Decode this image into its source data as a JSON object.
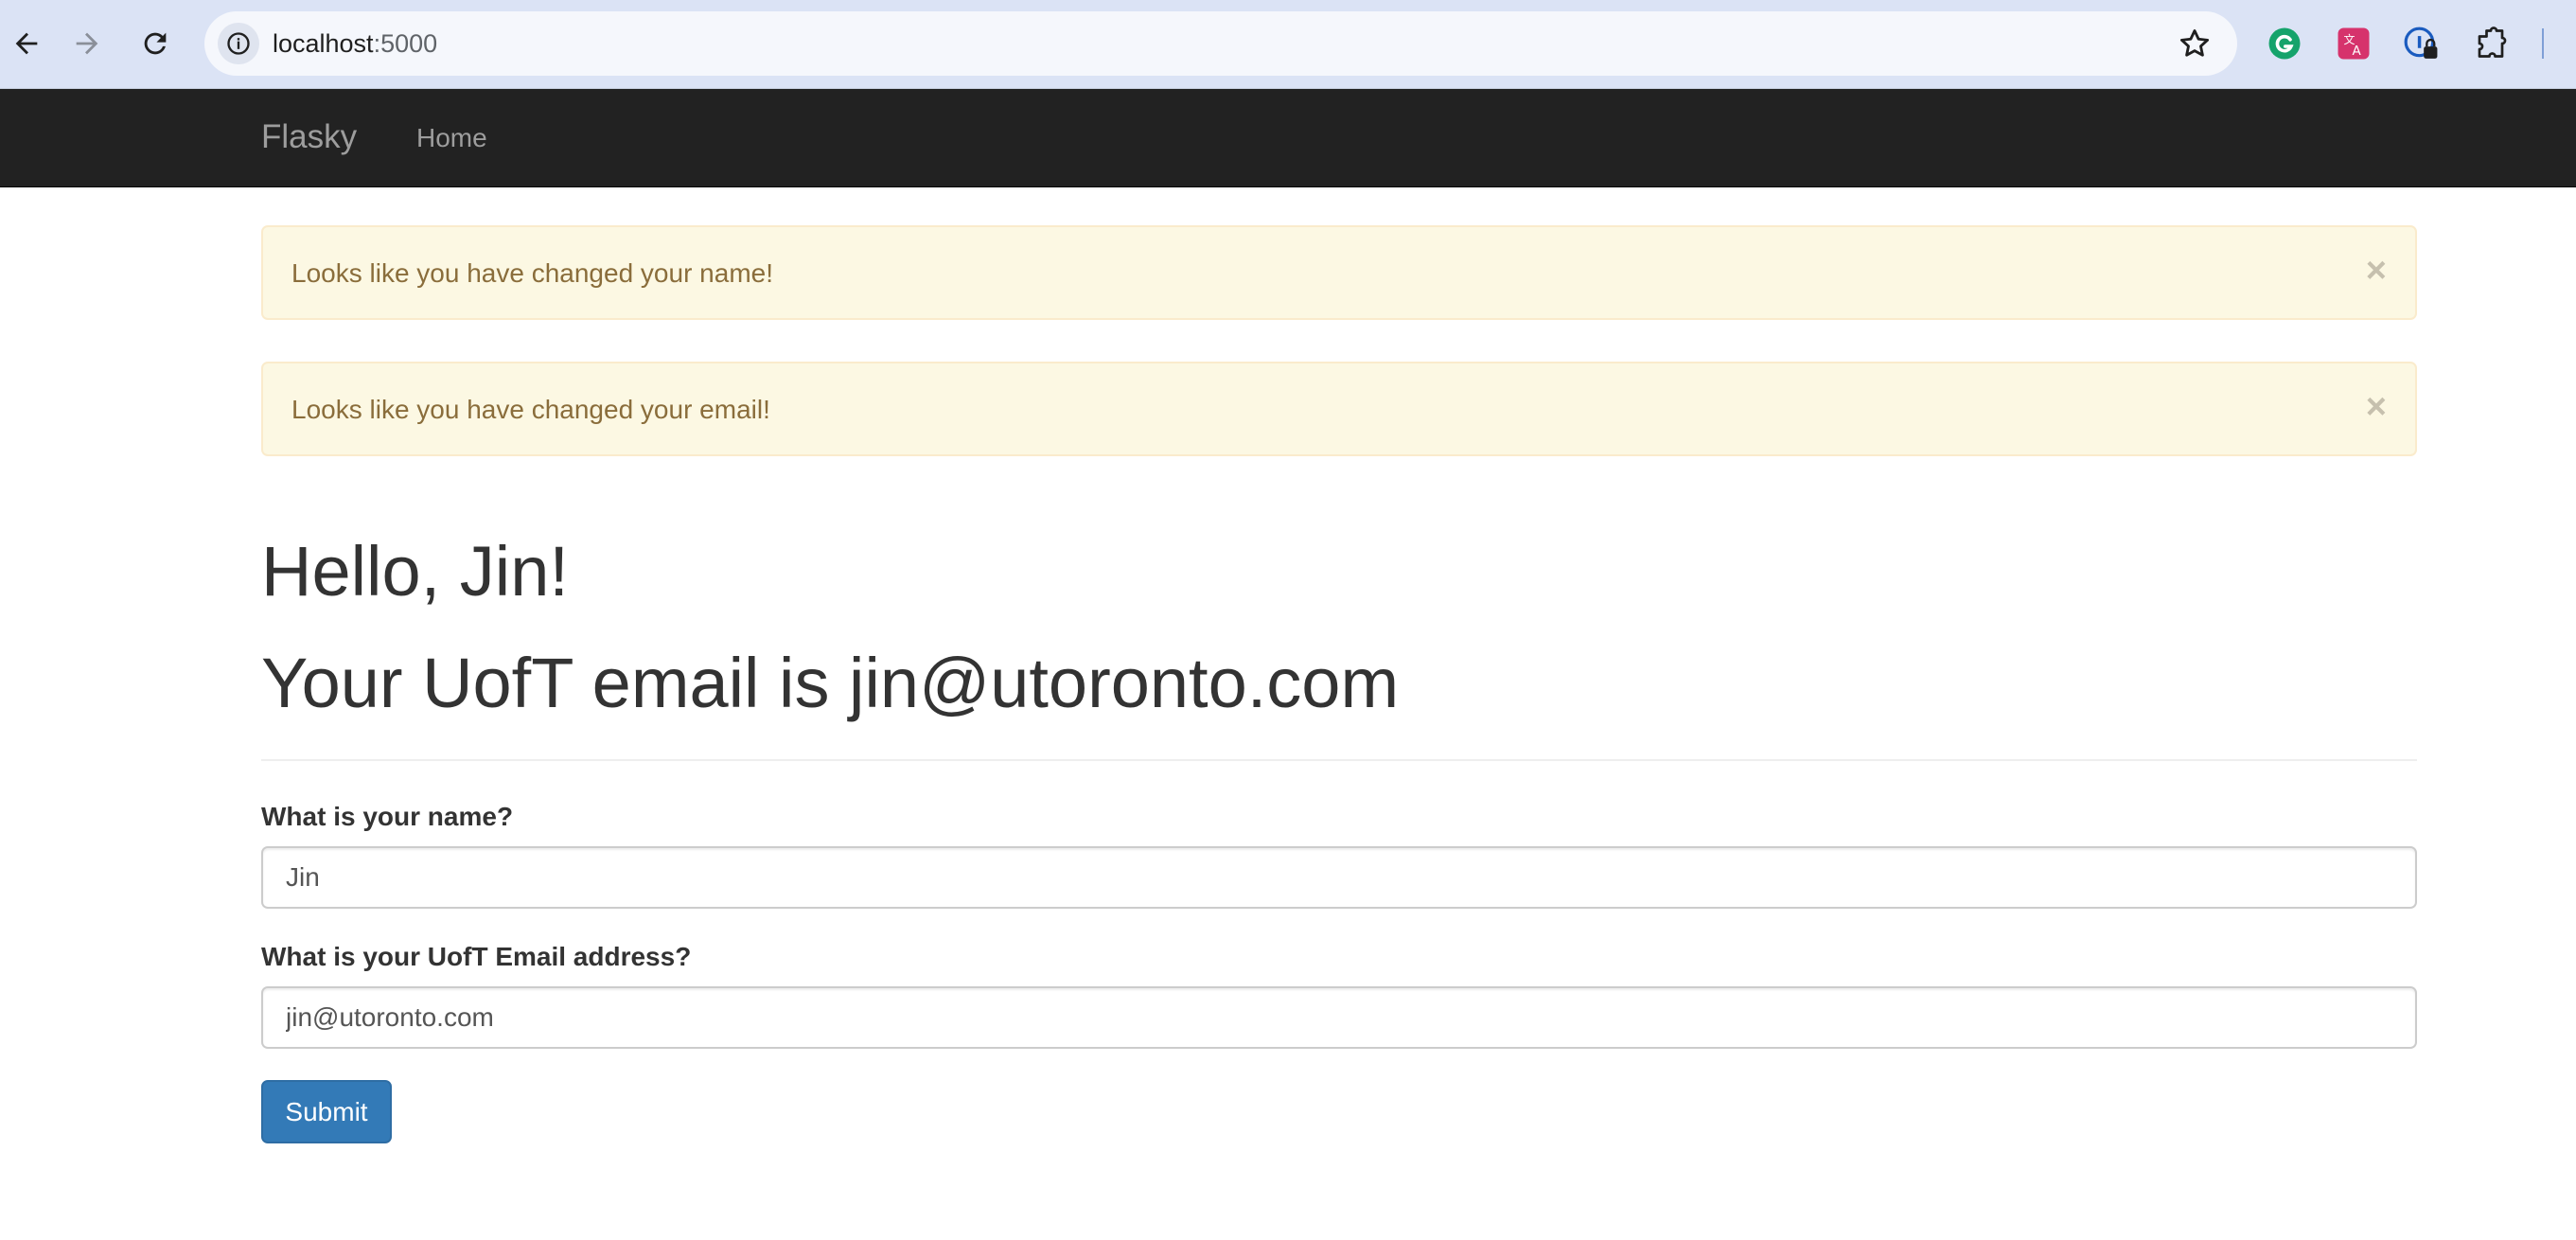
{
  "browser": {
    "url_host": "localhost",
    "url_port": ":5000",
    "icons": {
      "back": "back-arrow-icon",
      "forward": "forward-arrow-icon",
      "reload": "reload-icon",
      "site_info": "info-icon",
      "bookmark": "star-icon",
      "extensions": [
        "grammarly-icon",
        "translate-icon",
        "password-manager-icon",
        "puzzle-extensions-icon"
      ]
    }
  },
  "navbar": {
    "brand": "Flasky",
    "links": [
      "Home"
    ]
  },
  "alerts": [
    {
      "message": "Looks like you have changed your name!",
      "close": "×"
    },
    {
      "message": "Looks like you have changed your email!",
      "close": "×"
    }
  ],
  "page": {
    "greeting": "Hello, Jin!",
    "email_line": "Your UofT email is jin@utoronto.com"
  },
  "form": {
    "name_label": "What is your name?",
    "name_value": "Jin",
    "email_label": "What is your UofT Email address?",
    "email_value": "jin@utoronto.com",
    "submit_label": "Submit"
  },
  "colors": {
    "navbar_bg": "#222222",
    "alert_bg": "#fcf8e3",
    "alert_text": "#8a6d3b",
    "primary": "#337ab7"
  }
}
